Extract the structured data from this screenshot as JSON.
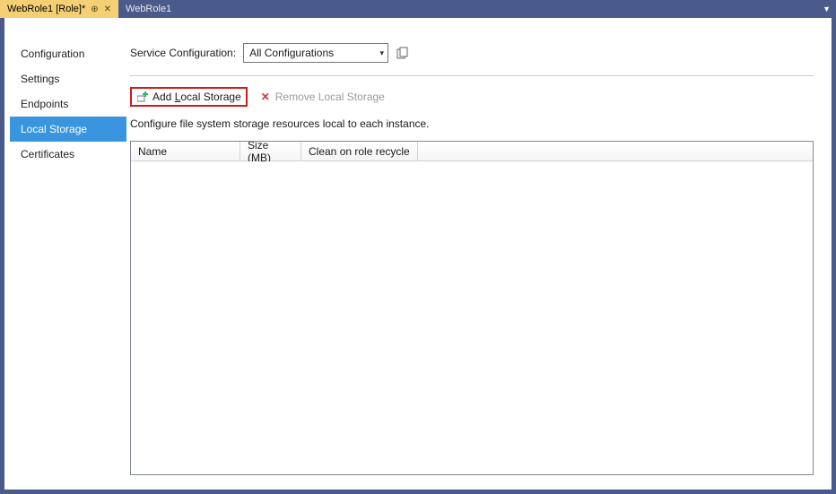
{
  "tabs": {
    "active": {
      "label": "WebRole1 [Role]*"
    },
    "inactive": {
      "label": "WebRole1"
    }
  },
  "sidebar": {
    "items": [
      {
        "label": "Configuration"
      },
      {
        "label": "Settings"
      },
      {
        "label": "Endpoints"
      },
      {
        "label": "Local Storage"
      },
      {
        "label": "Certificates"
      }
    ],
    "selectedIndex": 3
  },
  "config": {
    "label": "Service Configuration:",
    "selected": "All Configurations"
  },
  "toolbar": {
    "add": {
      "prefix": "Add ",
      "key": "L",
      "suffix": "ocal Storage"
    },
    "remove": {
      "label": "Remove Local Storage"
    }
  },
  "description": "Configure file system storage resources local to each instance.",
  "grid": {
    "columns": [
      "Name",
      "Size (MB)",
      "Clean on role recycle"
    ],
    "rows": []
  }
}
